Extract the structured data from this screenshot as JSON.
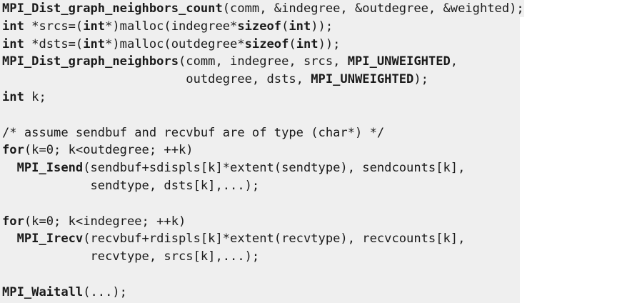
{
  "code": {
    "lines": [
      {
        "segments": [
          {
            "t": "MPI_Dist_graph_neighbors_count",
            "s": "fn"
          },
          {
            "t": "(comm, &indegree, &outdegree, &weighted);",
            "s": "plain"
          }
        ]
      },
      {
        "segments": [
          {
            "t": "int",
            "s": "kw"
          },
          {
            "t": " *srcs=(",
            "s": "plain"
          },
          {
            "t": "int",
            "s": "kw"
          },
          {
            "t": "*)malloc(indegree*",
            "s": "plain"
          },
          {
            "t": "sizeof",
            "s": "kw"
          },
          {
            "t": "(",
            "s": "plain"
          },
          {
            "t": "int",
            "s": "kw"
          },
          {
            "t": "));",
            "s": "plain"
          }
        ]
      },
      {
        "segments": [
          {
            "t": "int",
            "s": "kw"
          },
          {
            "t": " *dsts=(",
            "s": "plain"
          },
          {
            "t": "int",
            "s": "kw"
          },
          {
            "t": "*)malloc(outdegree*",
            "s": "plain"
          },
          {
            "t": "sizeof",
            "s": "kw"
          },
          {
            "t": "(",
            "s": "plain"
          },
          {
            "t": "int",
            "s": "kw"
          },
          {
            "t": "));",
            "s": "plain"
          }
        ]
      },
      {
        "segments": [
          {
            "t": "MPI_Dist_graph_neighbors",
            "s": "fn"
          },
          {
            "t": "(comm, indegree, srcs, ",
            "s": "plain"
          },
          {
            "t": "MPI_UNWEIGHTED",
            "s": "fn"
          },
          {
            "t": ",",
            "s": "plain"
          }
        ]
      },
      {
        "segments": [
          {
            "t": "                         outdegree, dsts, ",
            "s": "plain"
          },
          {
            "t": "MPI_UNWEIGHTED",
            "s": "fn"
          },
          {
            "t": ");",
            "s": "plain"
          }
        ]
      },
      {
        "segments": [
          {
            "t": "int",
            "s": "kw"
          },
          {
            "t": " k;",
            "s": "plain"
          }
        ]
      },
      {
        "segments": [
          {
            "t": "",
            "s": "plain"
          }
        ]
      },
      {
        "segments": [
          {
            "t": "/* assume sendbuf and recvbuf are of type (char*) */",
            "s": "plain"
          }
        ]
      },
      {
        "segments": [
          {
            "t": "for",
            "s": "kw"
          },
          {
            "t": "(k=0; k<outdegree; ++k)",
            "s": "plain"
          }
        ]
      },
      {
        "segments": [
          {
            "t": "  ",
            "s": "plain"
          },
          {
            "t": "MPI_Isend",
            "s": "fn"
          },
          {
            "t": "(sendbuf+sdispls[k]*extent(sendtype), sendcounts[k],",
            "s": "plain"
          }
        ]
      },
      {
        "segments": [
          {
            "t": "            sendtype, dsts[k],...);",
            "s": "plain"
          }
        ]
      },
      {
        "segments": [
          {
            "t": "",
            "s": "plain"
          }
        ]
      },
      {
        "segments": [
          {
            "t": "for",
            "s": "kw"
          },
          {
            "t": "(k=0; k<indegree; ++k)",
            "s": "plain"
          }
        ]
      },
      {
        "segments": [
          {
            "t": "  ",
            "s": "plain"
          },
          {
            "t": "MPI_Irecv",
            "s": "fn"
          },
          {
            "t": "(recvbuf+rdispls[k]*extent(recvtype), recvcounts[k],",
            "s": "plain"
          }
        ]
      },
      {
        "segments": [
          {
            "t": "            recvtype, srcs[k],...);",
            "s": "plain"
          }
        ]
      },
      {
        "segments": [
          {
            "t": "",
            "s": "plain"
          }
        ]
      },
      {
        "segments": [
          {
            "t": "MPI_Waitall",
            "s": "fn"
          },
          {
            "t": "(...);",
            "s": "plain"
          }
        ]
      }
    ]
  }
}
